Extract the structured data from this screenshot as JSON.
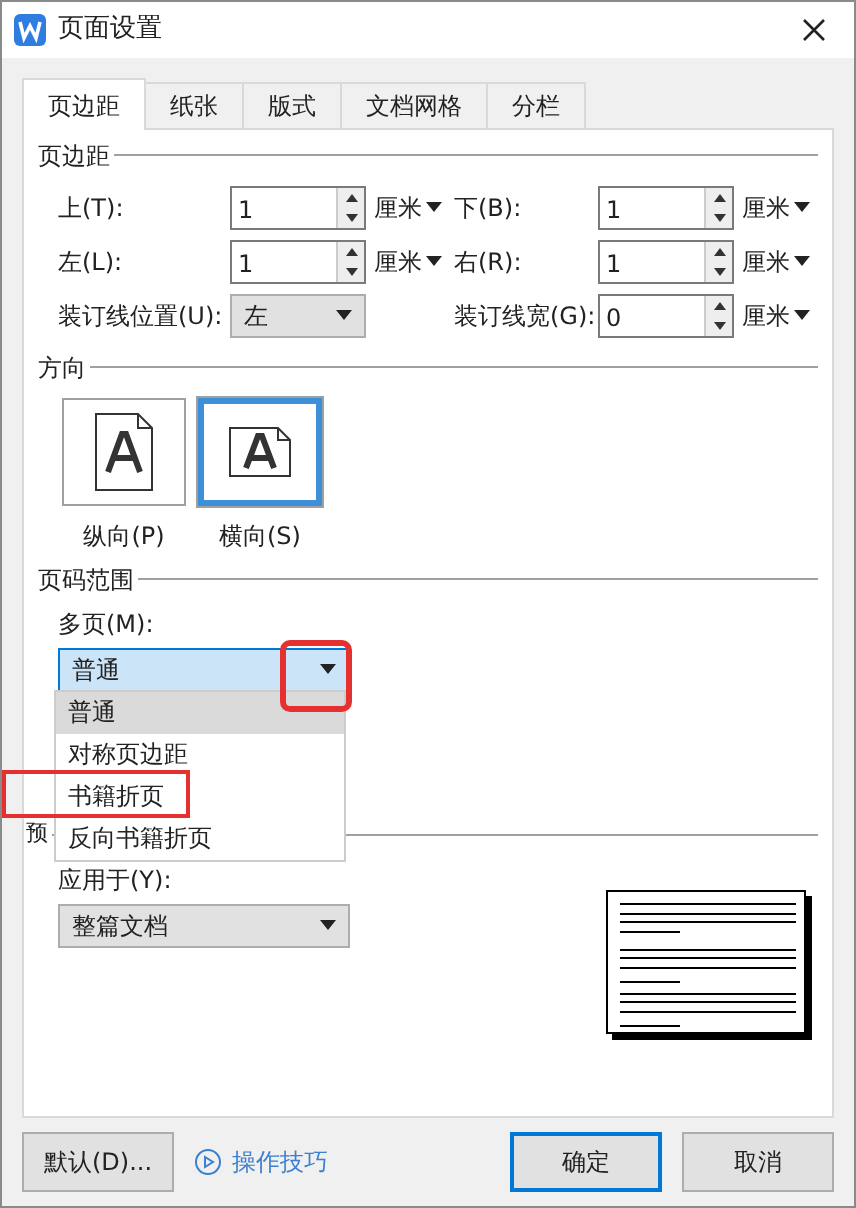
{
  "window": {
    "title": "页面设置"
  },
  "tabs": [
    {
      "label": "页边距",
      "selected": true
    },
    {
      "label": "纸张",
      "selected": false
    },
    {
      "label": "版式",
      "selected": false
    },
    {
      "label": "文档网格",
      "selected": false
    },
    {
      "label": "分栏",
      "selected": false
    }
  ],
  "margins": {
    "title": "页边距",
    "fields": [
      {
        "kind": "spin",
        "label": "上(T):",
        "value": "1",
        "unit": "厘米"
      },
      {
        "kind": "spin",
        "label": "下(B):",
        "value": "1",
        "unit": "厘米"
      },
      {
        "kind": "spin",
        "label": "左(L):",
        "value": "1",
        "unit": "厘米"
      },
      {
        "kind": "spin",
        "label": "右(R):",
        "value": "1",
        "unit": "厘米"
      },
      {
        "kind": "select",
        "label": "装订线位置(U):",
        "value": "左"
      },
      {
        "kind": "spin",
        "label": "装订线宽(G):",
        "value": "0",
        "unit": "厘米"
      }
    ]
  },
  "orientation": {
    "title": "方向",
    "options": [
      {
        "kind": "portrait",
        "label": "纵向(P)",
        "selected": false
      },
      {
        "kind": "landscape",
        "label": "横向(S)",
        "selected": true
      }
    ]
  },
  "pages": {
    "title": "页码范围",
    "label": "多页(M):",
    "value": "普通",
    "expanded": true,
    "arrow_highlighted": true,
    "options": [
      {
        "label": "普通",
        "selected": true,
        "highlighted": false
      },
      {
        "label": "对称页边距",
        "selected": false,
        "highlighted": false
      },
      {
        "label": "书籍折页",
        "selected": false,
        "highlighted": true
      },
      {
        "label": "反向书籍折页",
        "selected": false,
        "highlighted": false
      }
    ]
  },
  "preview": {
    "title": "预",
    "apply_label": "应用于(Y):",
    "apply_value": "整篇文档"
  },
  "buttons": {
    "default": "默认(D)...",
    "tips": "操作技巧",
    "ok": "确定",
    "cancel": "取消"
  }
}
